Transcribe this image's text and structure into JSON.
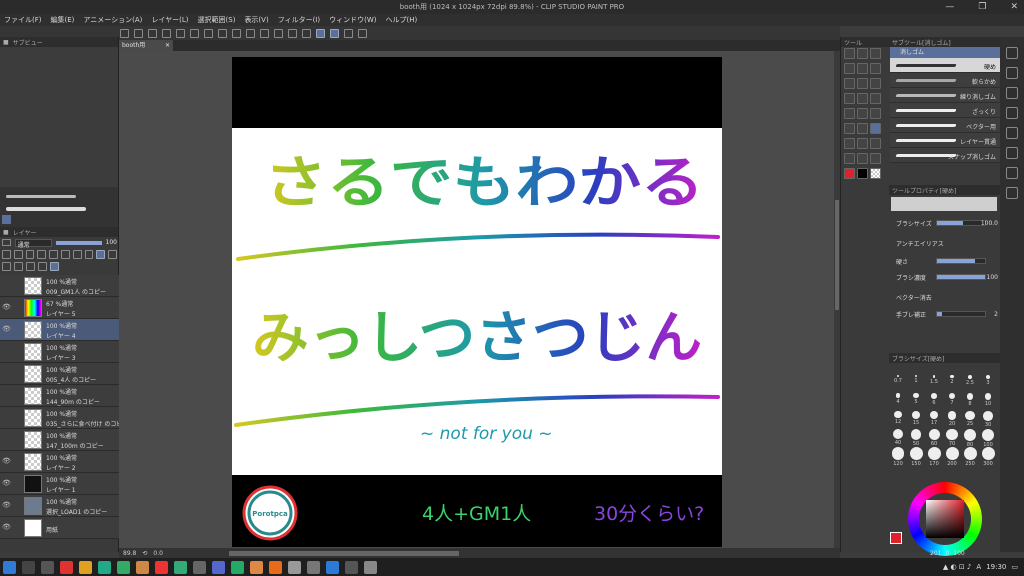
{
  "window": {
    "title": "booth用 (1024 x 1024px 72dpi 89.8%) - CLIP STUDIO PAINT PRO",
    "min": "—",
    "max": "❐",
    "close": "✕"
  },
  "menu": [
    "ファイル(F)",
    "編集(E)",
    "アニメーション(A)",
    "レイヤー(L)",
    "選択範囲(S)",
    "表示(V)",
    "フィルター(I)",
    "ウィンドウ(W)",
    "ヘルプ(H)"
  ],
  "doc_tab": "booth用",
  "left": {
    "subview_tab": "サブビュー",
    "layer_tab": "レイヤー",
    "blend_mode": "通常",
    "opacity": "100",
    "layers": [
      {
        "mode": "100 %通常",
        "name": "009_GM1人 のコピー",
        "visible": false,
        "selected": false
      },
      {
        "mode": "67 %通常",
        "name": "レイヤー 5",
        "visible": true,
        "selected": false,
        "rainbow": true
      },
      {
        "mode": "100 %通常",
        "name": "レイヤー 4",
        "visible": true,
        "selected": true
      },
      {
        "mode": "100 %通常",
        "name": "レイヤー 3",
        "visible": false,
        "selected": false
      },
      {
        "mode": "100 %通常",
        "name": "005_4人 のコピー",
        "visible": false,
        "selected": false
      },
      {
        "mode": "100 %通常",
        "name": "144_90m のコピー",
        "visible": false,
        "selected": false
      },
      {
        "mode": "100 %通常",
        "name": "035_さらに食べ付け のコピー",
        "visible": false,
        "selected": false
      },
      {
        "mode": "100 %通常",
        "name": "147_100m のコピー",
        "visible": false,
        "selected": false
      },
      {
        "mode": "100 %通常",
        "name": "レイヤー 2",
        "visible": true,
        "selected": false
      },
      {
        "mode": "100 %通常",
        "name": "レイヤー 1",
        "visible": true,
        "selected": false
      },
      {
        "mode": "100 %通常",
        "name": "選択_LOAD1 のコピー",
        "visible": true,
        "selected": false
      },
      {
        "mode": "",
        "name": "用紙",
        "visible": true,
        "selected": false
      }
    ]
  },
  "artwork": {
    "line1": "さるでもわかる",
    "line2": "みっしつさつじん",
    "subtitle": "~ not for you ~",
    "players": "4人+GM1人",
    "duration": "30分くらい?",
    "logo": "Porotpca"
  },
  "statusbar": {
    "zoom": "89.8",
    "angle": "0.0"
  },
  "right": {
    "tool_tab": "ツール",
    "subtool_tab": "サブツール[消しゴム]",
    "subtool_header": "消しゴム",
    "brushes": [
      "硬め",
      "軟らかめ",
      "練り消しゴム",
      "ざっくり",
      "ベクター用",
      "レイヤー貫通",
      "スナップ消しゴム"
    ],
    "tool_property_tab": "ツールプロパティ[硬め]",
    "props": [
      {
        "label": "ブラシサイズ",
        "value": "100.0",
        "fill": 0.55
      },
      {
        "label": "アンチエイリアス",
        "value": "",
        "fill": 0
      },
      {
        "label": "硬さ",
        "value": "",
        "fill": 0.8
      },
      {
        "label": "ブラシ濃度",
        "value": "100",
        "fill": 1.0
      },
      {
        "label": "ベクター消去",
        "value": "",
        "fill": 0
      },
      {
        "label": "手ブレ補正",
        "value": "2",
        "fill": 0.1
      }
    ],
    "brush_size_tab": "ブラシサイズ[硬め]",
    "sizes": [
      "0.7",
      "1",
      "1.5",
      "2",
      "2.5",
      "3",
      "4",
      "5",
      "6",
      "7",
      "8",
      "10",
      "12",
      "15",
      "17",
      "20",
      "25",
      "30",
      "40",
      "50",
      "60",
      "70",
      "80",
      "100",
      "120",
      "150",
      "170",
      "200",
      "250",
      "300"
    ],
    "color_values": {
      "h": "201",
      "s": "0",
      "v": "100"
    }
  },
  "colors": {
    "accent": "#5a6f9a",
    "main_color": "#e0202a",
    "sub_color": "#000000"
  },
  "taskbar": {
    "time": "19:30",
    "lang": "A"
  }
}
